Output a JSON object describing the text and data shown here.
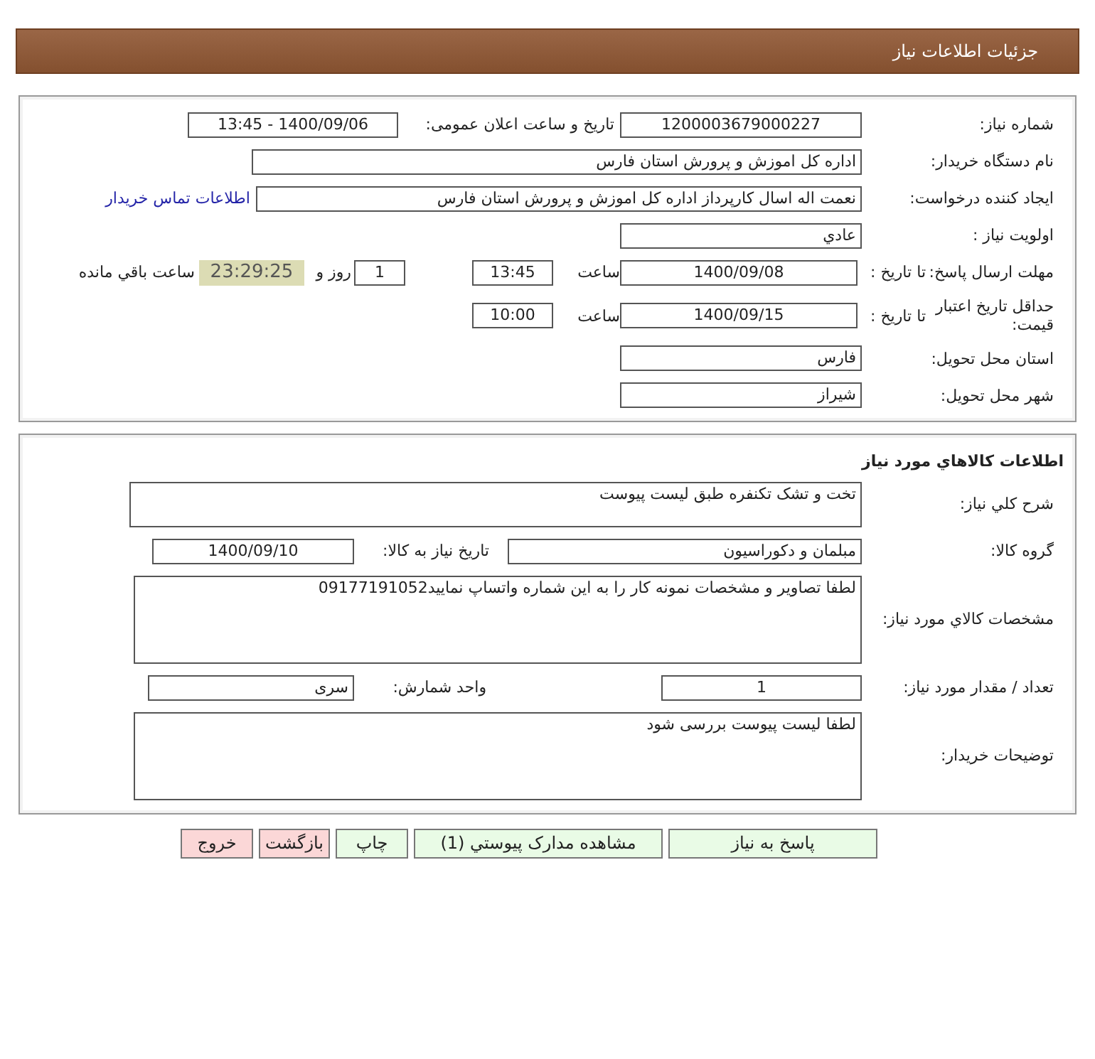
{
  "header": {
    "title": "جزئیات اطلاعات نیاز"
  },
  "sections": [
    {
      "rows": [
        {
          "items": [
            {
              "kind": "label",
              "text": "شماره نیاز:"
            },
            {
              "kind": "field",
              "text": "1200003679000227"
            },
            {
              "kind": "label",
              "text": "تاریخ و ساعت اعلان عمومی:"
            },
            {
              "kind": "field",
              "text": "1400/09/06 - 13:45"
            }
          ]
        },
        {
          "items": [
            {
              "kind": "label",
              "text": "نام دستگاه خریدار:"
            },
            {
              "kind": "field",
              "text": "اداره کل اموزش و پرورش استان فارس"
            }
          ]
        },
        {
          "items": [
            {
              "kind": "label",
              "text": "ایجاد کننده درخواست:"
            },
            {
              "kind": "field",
              "text": "نعمت اله اسال کارپرداز اداره کل اموزش و پرورش استان فارس"
            },
            {
              "kind": "link",
              "text": "اطلاعات تماس خریدار"
            }
          ]
        },
        {
          "items": [
            {
              "kind": "label",
              "text": "اولویت نیاز :"
            },
            {
              "kind": "field",
              "text": "عادي"
            }
          ]
        },
        {
          "items": [
            {
              "kind": "label",
              "text": "مهلت ارسال پاسخ:"
            },
            {
              "kind": "label",
              "text": "تا تاریخ :"
            },
            {
              "kind": "field",
              "text": "1400/09/08"
            },
            {
              "kind": "label",
              "text": "ساعت"
            },
            {
              "kind": "field",
              "text": "13:45"
            },
            {
              "kind": "field",
              "text": "1"
            },
            {
              "kind": "label",
              "text": "روز و"
            },
            {
              "kind": "timer",
              "text": "23:29:25"
            },
            {
              "kind": "label",
              "text": "ساعت باقي مانده"
            }
          ]
        },
        {
          "items": [
            {
              "kind": "label",
              "text": "حداقل تاریخ اعتبار قیمت:"
            },
            {
              "kind": "label",
              "text": "تا تاریخ :"
            },
            {
              "kind": "field",
              "text": "1400/09/15"
            },
            {
              "kind": "label",
              "text": "ساعت"
            },
            {
              "kind": "field",
              "text": "10:00"
            }
          ]
        },
        {
          "items": [
            {
              "kind": "label",
              "text": "استان محل تحویل:"
            },
            {
              "kind": "field",
              "text": "فارس"
            }
          ]
        },
        {
          "items": [
            {
              "kind": "label",
              "text": "شهر محل تحویل:"
            },
            {
              "kind": "field",
              "text": "شیراز"
            }
          ]
        }
      ]
    },
    {
      "title": "اطلاعات کالاهاي مورد نیاز",
      "rows": [
        {
          "items": [
            {
              "kind": "label",
              "text": "شرح کلي نیاز:"
            },
            {
              "kind": "textarea",
              "text": "تخت و تشک تکنفره طبق لیست پیوست"
            }
          ]
        },
        {
          "items": [
            {
              "kind": "label",
              "text": "گروه کالا:"
            },
            {
              "kind": "field",
              "text": "مبلمان و دکوراسیون"
            },
            {
              "kind": "label",
              "text": "تاریخ نیاز به کالا:"
            },
            {
              "kind": "field",
              "text": "1400/09/10"
            }
          ]
        },
        {
          "items": [
            {
              "kind": "label",
              "text": "مشخصات کالاي مورد نیاز:"
            },
            {
              "kind": "textarea",
              "text": "لطفا تصاویر و مشخصات نمونه کار را به این شماره واتساپ نمایید09177191052"
            }
          ]
        },
        {
          "items": [
            {
              "kind": "label",
              "text": "تعداد / مقدار مورد نیاز:"
            },
            {
              "kind": "field",
              "text": "1"
            },
            {
              "kind": "label",
              "text": "واحد شمارش:"
            },
            {
              "kind": "field",
              "text": "سری"
            }
          ]
        },
        {
          "items": [
            {
              "kind": "label",
              "text": "توضیحات خریدار:"
            },
            {
              "kind": "textarea",
              "text": "لطفا لیست پیوست بررسی شود"
            }
          ]
        }
      ]
    }
  ],
  "buttons": [
    {
      "label": "پاسخ به نیاز",
      "kind": "normal"
    },
    {
      "label": "مشاهده مدارک پیوستي (1)",
      "kind": "normal"
    },
    {
      "label": "چاپ",
      "kind": "normal"
    },
    {
      "label": "بازگشت",
      "kind": "danger"
    },
    {
      "label": "خروج",
      "kind": "danger"
    }
  ]
}
